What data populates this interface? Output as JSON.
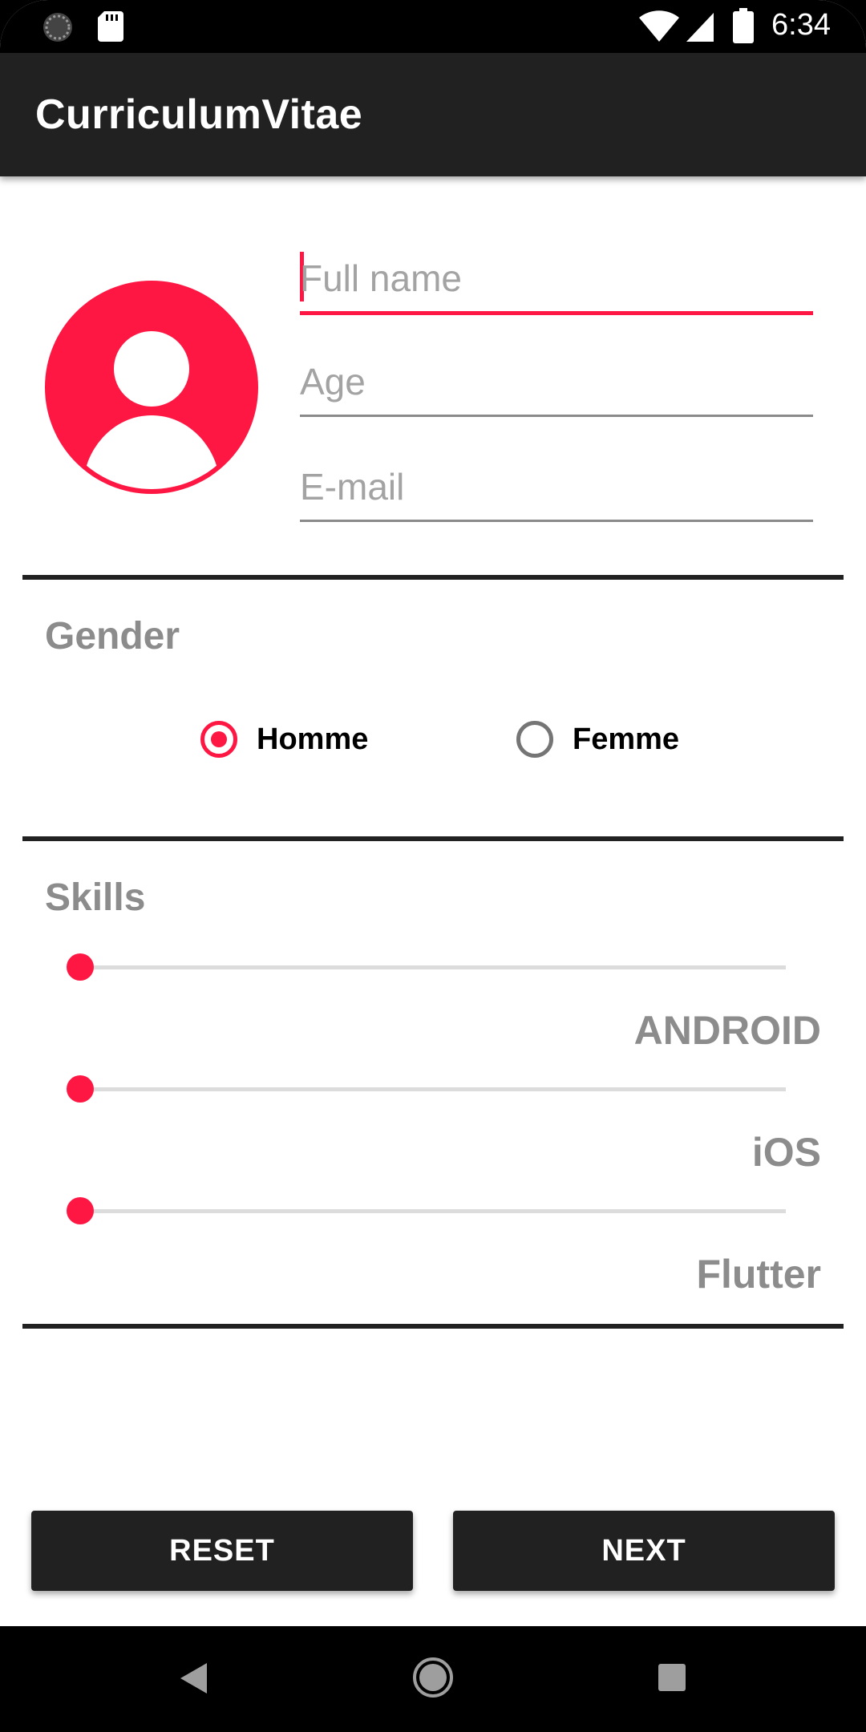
{
  "status_bar": {
    "time": "6:34",
    "icons": [
      "sync-icon",
      "sd-card-icon",
      "wifi-icon",
      "signal-icon",
      "battery-icon"
    ]
  },
  "app_bar": {
    "title": "CurriculumVitae"
  },
  "profile": {
    "avatar_icon": "account-circle-icon",
    "fields": {
      "full_name": {
        "placeholder": "Full name",
        "value": ""
      },
      "age": {
        "placeholder": "Age",
        "value": ""
      },
      "email": {
        "placeholder": "E-mail",
        "value": ""
      }
    }
  },
  "gender": {
    "title": "Gender",
    "options": [
      {
        "label": "Homme",
        "checked": true
      },
      {
        "label": "Femme",
        "checked": false
      }
    ]
  },
  "skills": {
    "title": "Skills",
    "items": [
      {
        "label": "ANDROID",
        "value": 0
      },
      {
        "label": "iOS",
        "value": 0
      },
      {
        "label": "Flutter",
        "value": 0
      }
    ]
  },
  "buttons": {
    "reset": "RESET",
    "next": "NEXT"
  },
  "colors": {
    "accent": "#ff1744",
    "app_bar": "#212121",
    "section_title": "#8c8c8c"
  },
  "nav_bar": {
    "icons": [
      "back-icon",
      "home-icon",
      "recents-icon"
    ]
  }
}
